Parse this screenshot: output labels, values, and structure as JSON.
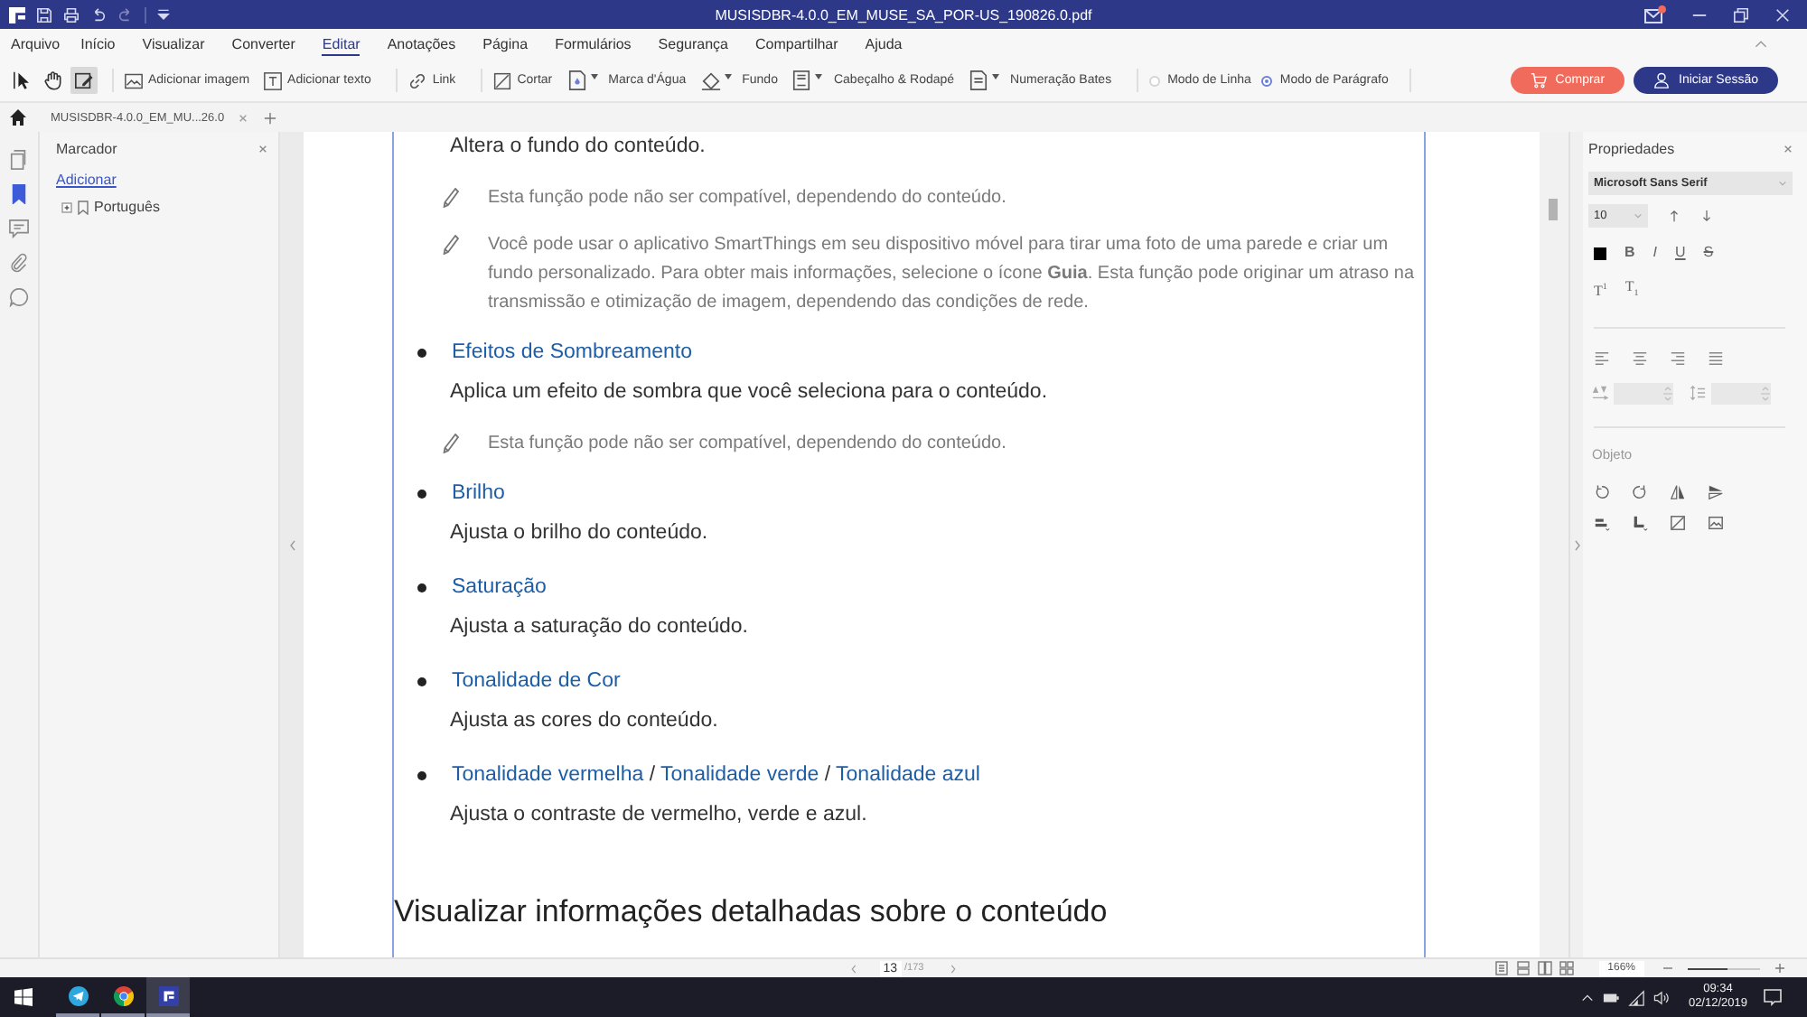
{
  "title_bar": {
    "title": "MUSISDBR-4.0.0_EM_MUSE_SA_POR-US_190826.0.pdf",
    "mail_badge": true
  },
  "menu": [
    {
      "label": "Arquivo",
      "selected": false
    },
    {
      "label": "Início",
      "selected": false
    },
    {
      "label": "Visualizar",
      "selected": false
    },
    {
      "label": "Converter",
      "selected": false
    },
    {
      "label": "Editar",
      "selected": true
    },
    {
      "label": "Anotações",
      "selected": false
    },
    {
      "label": "Página",
      "selected": false
    },
    {
      "label": "Formulários",
      "selected": false
    },
    {
      "label": "Segurança",
      "selected": false
    },
    {
      "label": "Compartilhar",
      "selected": false
    },
    {
      "label": "Ajuda",
      "selected": false
    }
  ],
  "toolbar": {
    "tools": [
      {
        "kind": "pointer",
        "selected": false
      },
      {
        "kind": "hand",
        "selected": false
      },
      {
        "kind": "edit",
        "selected": true
      }
    ],
    "action_groups": [
      [
        {
          "kind": "image",
          "label": "Adicionar imagem",
          "dropdown": false
        },
        {
          "kind": "text",
          "label": "Adicionar texto",
          "dropdown": false
        }
      ],
      [
        {
          "kind": "link",
          "label": "Link",
          "dropdown": false
        }
      ],
      [
        {
          "kind": "crop",
          "label": "Cortar",
          "dropdown": false
        },
        {
          "kind": "watermark",
          "label": "Marca d'Água",
          "dropdown": true
        },
        {
          "kind": "background",
          "label": "Fundo",
          "dropdown": true
        },
        {
          "kind": "header_footer",
          "label": "Cabeçalho & Rodapé",
          "dropdown": true
        },
        {
          "kind": "bates",
          "label": "Numeração Bates",
          "dropdown": true
        }
      ]
    ],
    "modes": [
      {
        "label": "Modo de Linha",
        "selected": false
      },
      {
        "label": "Modo de Parágrafo",
        "selected": true
      }
    ],
    "buy_button": "Comprar",
    "sign_in_button": "Iniciar Sessão"
  },
  "document_tabs": [
    {
      "label": "MUSISDBR-4.0.0_EM_MU...26.0"
    }
  ],
  "sidebar": {
    "rail": [
      {
        "kind": "pages",
        "selected": false
      },
      {
        "kind": "bookmarks",
        "selected": true
      },
      {
        "kind": "comments",
        "selected": false
      },
      {
        "kind": "attachments",
        "selected": false
      },
      {
        "kind": "search",
        "selected": false
      }
    ],
    "title": "Marcador",
    "add_link": "Adicionar",
    "tree": [
      {
        "label": "Português",
        "expanded": false
      }
    ]
  },
  "document": {
    "blocks": [
      {
        "kind": "body",
        "text": "Altera o fundo do conteúdo."
      },
      {
        "kind": "note",
        "text": "Esta função pode não ser compatível, dependendo do conteúdo."
      },
      {
        "kind": "note",
        "text": "Você pode usar o aplicativo SmartThings em seu dispositivo móvel para tirar uma foto de uma parede e criar um fundo personalizado. Para obter mais informações, selecione o ícone **Guia**. Esta função pode originar um atraso na transmissão e otimização de imagem, dependendo das condições de rede."
      },
      {
        "kind": "bullet",
        "parts": [
          {
            "kind": "term",
            "text": "Efeitos de Sombreamento"
          }
        ]
      },
      {
        "kind": "body",
        "text": "Aplica um efeito de sombra que você seleciona para o conteúdo."
      },
      {
        "kind": "note",
        "text": "Esta função pode não ser compatível, dependendo do conteúdo."
      },
      {
        "kind": "bullet",
        "parts": [
          {
            "kind": "term",
            "text": "Brilho"
          }
        ]
      },
      {
        "kind": "body",
        "text": "Ajusta o brilho do conteúdo."
      },
      {
        "kind": "bullet",
        "parts": [
          {
            "kind": "term",
            "text": "Saturação"
          }
        ]
      },
      {
        "kind": "body",
        "text": "Ajusta a saturação do conteúdo."
      },
      {
        "kind": "bullet",
        "parts": [
          {
            "kind": "term",
            "text": "Tonalidade de Cor"
          }
        ]
      },
      {
        "kind": "body",
        "text": "Ajusta as cores do conteúdo."
      },
      {
        "kind": "bullet",
        "parts": [
          {
            "kind": "term",
            "text": "Tonalidade vermelha"
          },
          {
            "kind": "plain",
            "text": "/"
          },
          {
            "kind": "term",
            "text": "Tonalidade verde"
          },
          {
            "kind": "plain",
            "text": "/"
          },
          {
            "kind": "term",
            "text": "Tonalidade azul"
          }
        ]
      },
      {
        "kind": "body",
        "text": "Ajusta o contraste de vermelho, verde e azul."
      },
      {
        "kind": "heading",
        "text": "Visualizar informações detalhadas sobre o conteúdo"
      }
    ]
  },
  "properties": {
    "title": "Propriedades",
    "font": "Microsoft Sans Serif",
    "size": "10",
    "styles": [
      {
        "kind": "bold",
        "label": "B"
      },
      {
        "kind": "italic",
        "label": "I"
      },
      {
        "kind": "underline",
        "label": "U"
      },
      {
        "kind": "strike",
        "label": "S"
      }
    ],
    "scripts": [
      {
        "kind": "superscript",
        "label": "T",
        "index": "1"
      },
      {
        "kind": "subscript",
        "label": "T",
        "index": "1"
      }
    ],
    "object_title": "Objeto"
  },
  "status_bar": {
    "page": "13",
    "total": "/173",
    "zoom": "166%",
    "zoom_slider": {
      "level": 0.55
    }
  },
  "taskbar": {
    "apps": [
      {
        "kind": "messenger",
        "selected": false
      },
      {
        "kind": "browser",
        "selected": false
      },
      {
        "kind": "editor",
        "selected": true
      }
    ],
    "time": "09:34",
    "date": "02/12/2019"
  }
}
